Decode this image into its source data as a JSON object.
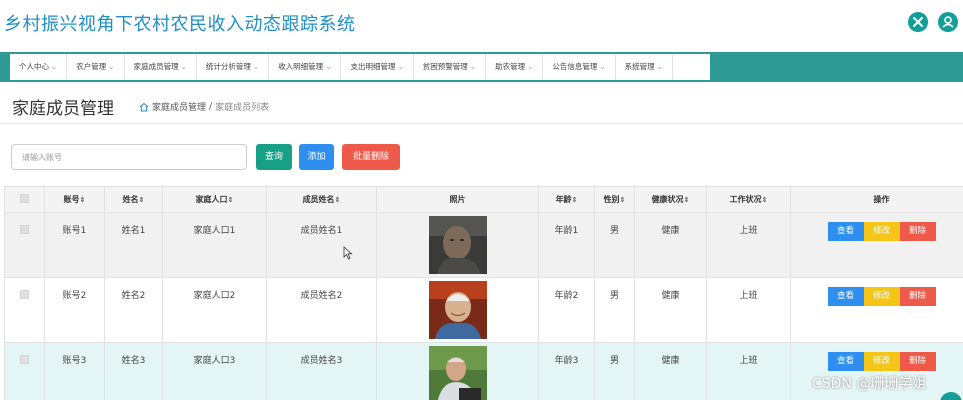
{
  "app": {
    "title": "乡村振兴视角下农村农民收入动态跟踪系统"
  },
  "header_icons": [
    "expand-icon",
    "user-icon"
  ],
  "nav": [
    "个人中心",
    "农户管理",
    "家庭成员管理",
    "统计分析管理",
    "收入明细管理",
    "支出明细管理",
    "贫困预警管理",
    "助农管理",
    "公告信息管理",
    "系统管理"
  ],
  "page": {
    "title": "家庭成员管理"
  },
  "breadcrumb": {
    "section": "家庭成员管理",
    "sep": "/",
    "current": "家庭成员列表"
  },
  "search": {
    "placeholder": "请输入账号",
    "value": ""
  },
  "buttons": {
    "query": "查询",
    "add": "添加",
    "batch_delete": "批量删除"
  },
  "table": {
    "headers": {
      "account": "账号",
      "name": "姓名",
      "household": "家庭人口",
      "member_name": "成员姓名",
      "photo": "照片",
      "age": "年龄",
      "gender": "性别",
      "health": "健康状况",
      "work": "工作状况",
      "actions": "操作"
    },
    "sort_glyph": "⇕",
    "rows": [
      {
        "account": "账号1",
        "name": "姓名1",
        "household": "家庭人口1",
        "member_name": "成员姓名1",
        "age": "年龄1",
        "gender": "男",
        "health": "健康",
        "work": "上班"
      },
      {
        "account": "账号2",
        "name": "姓名2",
        "household": "家庭人口2",
        "member_name": "成员姓名2",
        "age": "年龄2",
        "gender": "男",
        "health": "健康",
        "work": "上班"
      },
      {
        "account": "账号3",
        "name": "姓名3",
        "household": "家庭人口3",
        "member_name": "成员姓名3",
        "age": "年龄3",
        "gender": "男",
        "health": "健康",
        "work": "上班"
      }
    ],
    "row_actions": {
      "view": "查看",
      "edit": "修改",
      "delete": "删除"
    }
  },
  "watermark": "CSDN @珊珊学姐",
  "colors": {
    "title_blue": "#1f8fc6",
    "teal": "#2e9a96",
    "query_green": "#17a085",
    "add_blue": "#2e8ff0",
    "delete_red": "#ee5a4a",
    "edit_yellow": "#f5c518"
  }
}
